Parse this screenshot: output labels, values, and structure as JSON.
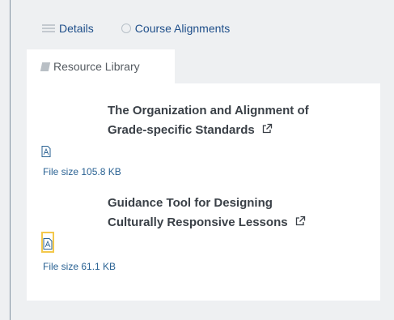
{
  "tabs": [
    {
      "label": "Details",
      "icon": "list-icon"
    },
    {
      "label": "Course Alignments",
      "icon": "circle-icon"
    }
  ],
  "active_tab": {
    "label": "Resource Library",
    "icon": "book-icon"
  },
  "resources": [
    {
      "title_line1": "The Organization and Alignment of",
      "title_line2": "Grade-specific Standards",
      "file_icon": "pdf-file-icon",
      "file_size": "File size 105.8 KB"
    },
    {
      "title_line1": "Guidance Tool for Designing",
      "title_line2": "Culturally Responsive Lessons",
      "file_icon": "pdf-file-icon",
      "file_size": "File size 61.1 KB"
    }
  ],
  "colors": {
    "link": "#1f4f8a",
    "focus": "#f3c84b",
    "title": "#3a4047"
  }
}
